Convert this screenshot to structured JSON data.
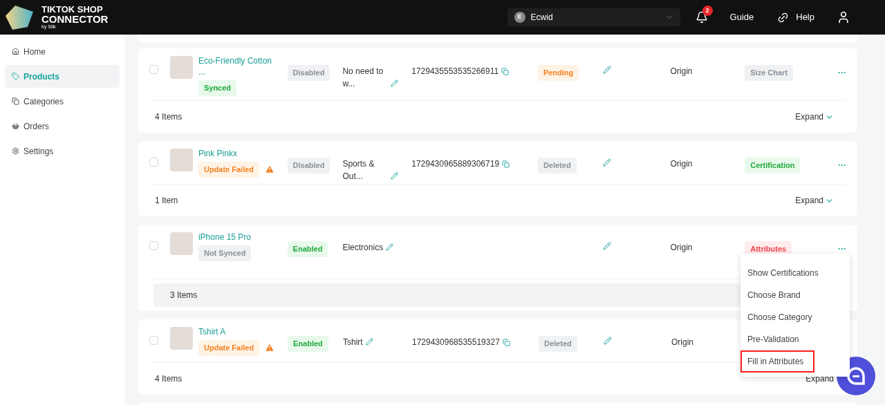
{
  "header": {
    "logo_line_1": "TIKTOK SHOP",
    "logo_line_2": "CONNECTOR",
    "logo_byline": "by Silk",
    "store": {
      "initial": "E",
      "name": "Ecwid"
    },
    "notifications": "2",
    "guide": "Guide",
    "help": "Help"
  },
  "sidebar": {
    "items": [
      {
        "label": "Home",
        "selected": false
      },
      {
        "label": "Products",
        "selected": true
      },
      {
        "label": "Categories",
        "selected": false
      },
      {
        "label": "Orders",
        "selected": false
      },
      {
        "label": "Settings",
        "selected": false
      }
    ]
  },
  "products": [
    {
      "name": "Eco-Friendly Cotton ...",
      "checked": false,
      "sync": {
        "label": "Synced",
        "kind": "green"
      },
      "warning": false,
      "state": {
        "label": "Disabled",
        "kind": "gray"
      },
      "category": "No need to w...",
      "id": "1729435553535266911",
      "listing": {
        "label": "Pending",
        "kind": "orange"
      },
      "origin": "Origin",
      "tag": {
        "label": "Size Chart",
        "kind": "gray"
      },
      "more": "···",
      "footer": "4 Items",
      "expand": "Expand",
      "footer_highlighted": false
    },
    {
      "name": "Pink Pinkx",
      "checked": false,
      "sync": {
        "label": "Update Failed",
        "kind": "orange"
      },
      "warning": true,
      "state": {
        "label": "Disabled",
        "kind": "gray"
      },
      "category": "Sports & Out...",
      "id": "1729430965889306719",
      "listing": {
        "label": "Deleted",
        "kind": "gray"
      },
      "origin": "Origin",
      "tag": {
        "label": "Certification",
        "kind": "green"
      },
      "more": "···",
      "footer": "1 Item",
      "expand": "Expand",
      "footer_highlighted": false
    },
    {
      "name": "iPhone 15 Pro",
      "checked": false,
      "sync": {
        "label": "Not Synced",
        "kind": "gray"
      },
      "warning": false,
      "state": {
        "label": "Enabled",
        "kind": "green"
      },
      "category": "Electronics",
      "origin": "Origin",
      "tag": {
        "label": "Attributes",
        "kind": "red"
      },
      "more": "···",
      "footer": "3 Items",
      "footer_highlighted": true,
      "menu": [
        {
          "label": "Show Certifications",
          "highlighted": false
        },
        {
          "label": "Choose Brand",
          "highlighted": false
        },
        {
          "label": "Choose Category",
          "highlighted": false
        },
        {
          "label": "Pre-Validation",
          "highlighted": false
        },
        {
          "label": "Fill in Attributes",
          "highlighted": true
        }
      ]
    },
    {
      "name": "Tshirt A",
      "checked": false,
      "sync": {
        "label": "Update Failed",
        "kind": "orange"
      },
      "warning": true,
      "state": {
        "label": "Enabled",
        "kind": "green"
      },
      "category": "Tshirt",
      "id": "1729430968535519327",
      "listing": {
        "label": "Deleted",
        "kind": "gray"
      },
      "origin": "Origin",
      "footer": "4 Items",
      "expand": "Expand",
      "footer_highlighted": false
    }
  ]
}
